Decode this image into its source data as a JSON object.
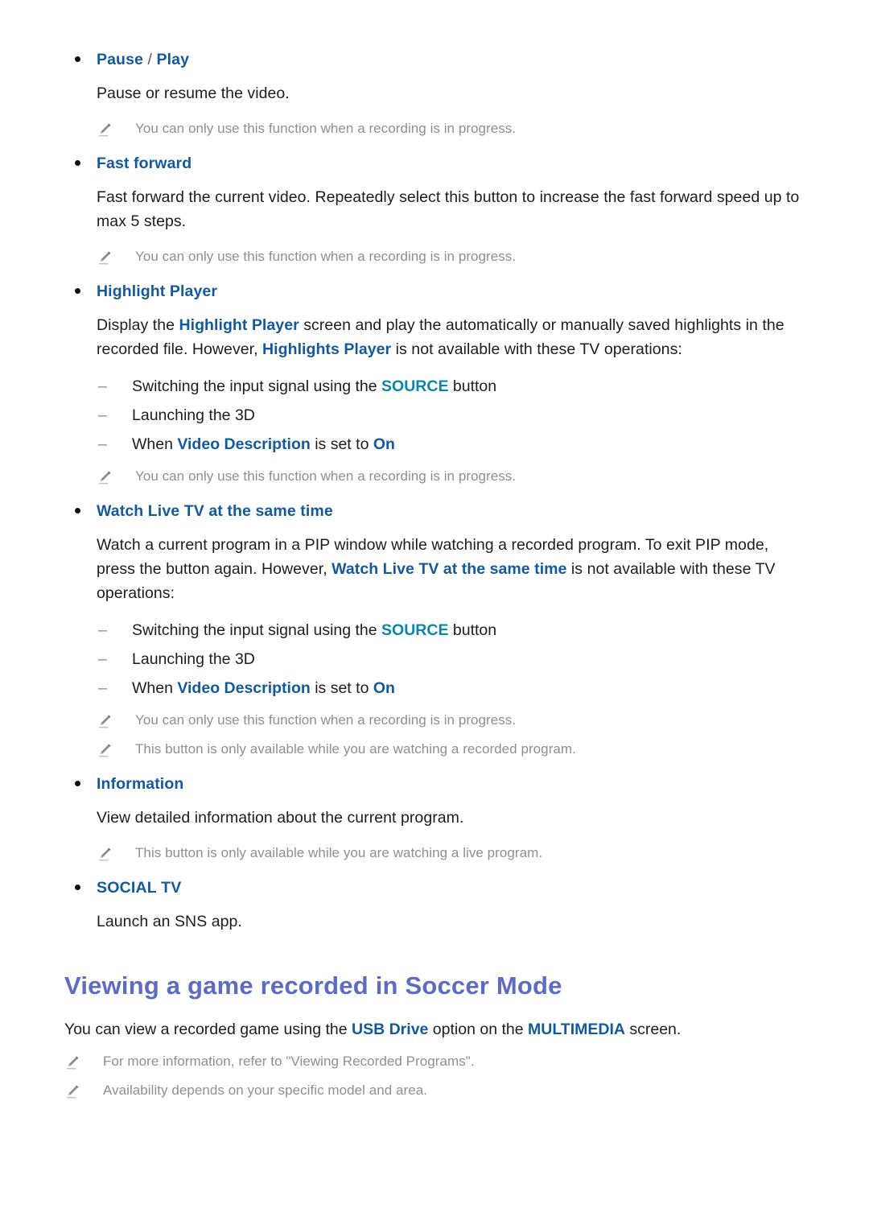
{
  "document": {
    "colors": {
      "link_blue": "#14599b",
      "source_teal": "#0b86a8",
      "heading_purple": "#5c6cc0",
      "note_gray": "#8f8f8f",
      "body_black": "#1d1d1d"
    }
  },
  "items": [
    {
      "id": "pause-play",
      "title_parts": [
        "Pause",
        " / ",
        "Play"
      ],
      "title_plain": "Pause / Play",
      "body": "Pause or resume the video.",
      "notes": [
        "You can only use this function when a recording is in progress."
      ]
    },
    {
      "id": "fast-forward",
      "title_plain": "Fast forward",
      "body": "Fast forward the current video. Repeatedly select this button to increase the fast forward speed up to max 5 steps.",
      "notes": [
        "You can only use this function when a recording is in progress."
      ]
    },
    {
      "id": "highlight-player",
      "title_plain": "Highlight Player",
      "body_segments": [
        {
          "text": "Display the ",
          "style": "plain"
        },
        {
          "text": "Highlight Player",
          "style": "blue"
        },
        {
          "text": " screen and play the automatically or manually saved highlights in the recorded file. However, ",
          "style": "plain"
        },
        {
          "text": "Highlights Player",
          "style": "blue"
        },
        {
          "text": " is not available with these TV operations:",
          "style": "plain"
        }
      ],
      "sub_items": [
        [
          {
            "text": "Switching the input signal using the ",
            "style": "plain"
          },
          {
            "text": "SOURCE",
            "style": "teal"
          },
          {
            "text": " button",
            "style": "plain"
          }
        ],
        [
          {
            "text": "Launching the 3D",
            "style": "plain"
          }
        ],
        [
          {
            "text": "When ",
            "style": "plain"
          },
          {
            "text": "Video Description",
            "style": "blue"
          },
          {
            "text": " is set to ",
            "style": "plain"
          },
          {
            "text": "On",
            "style": "blue"
          }
        ]
      ],
      "notes": [
        "You can only use this function when a recording is in progress."
      ]
    },
    {
      "id": "watch-live-tv",
      "title_plain": "Watch Live TV at the same time",
      "body_segments": [
        {
          "text": "Watch a current program in a PIP window while watching a recorded program. To exit PIP mode, press the button again. However, ",
          "style": "plain"
        },
        {
          "text": "Watch Live TV at the same time",
          "style": "blue"
        },
        {
          "text": " is not available with these TV operations:",
          "style": "plain"
        }
      ],
      "sub_items": [
        [
          {
            "text": "Switching the input signal using the ",
            "style": "plain"
          },
          {
            "text": "SOURCE",
            "style": "teal"
          },
          {
            "text": " button",
            "style": "plain"
          }
        ],
        [
          {
            "text": "Launching the 3D",
            "style": "plain"
          }
        ],
        [
          {
            "text": "When ",
            "style": "plain"
          },
          {
            "text": "Video Description",
            "style": "blue"
          },
          {
            "text": " is set to ",
            "style": "plain"
          },
          {
            "text": "On",
            "style": "blue"
          }
        ]
      ],
      "notes": [
        "You can only use this function when a recording is in progress.",
        "This button is only available while you are watching a recorded program."
      ]
    },
    {
      "id": "information",
      "title_plain": "Information",
      "body": "View detailed information about the current program.",
      "notes": [
        "This button is only available while you are watching a live program."
      ]
    },
    {
      "id": "social-tv",
      "title_plain": "SOCIAL TV",
      "body": "Launch an SNS app.",
      "notes": []
    }
  ],
  "section": {
    "heading": "Viewing a game recorded in Soccer Mode",
    "lead_segments": [
      {
        "text": "You can view a recorded game using the ",
        "style": "plain"
      },
      {
        "text": "USB Drive",
        "style": "blue"
      },
      {
        "text": " option on the ",
        "style": "plain"
      },
      {
        "text": "MULTIMEDIA",
        "style": "blue"
      },
      {
        "text": " screen.",
        "style": "plain"
      }
    ],
    "notes": [
      "For more information, refer to \"Viewing Recorded Programs\".",
      "Availability depends on your specific model and area."
    ]
  },
  "icons": {
    "note": "pencil-icon",
    "bullet": "bullet-dot-icon",
    "dash": "dash-marker-icon"
  }
}
